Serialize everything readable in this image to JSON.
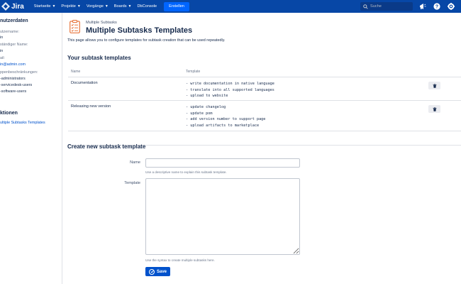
{
  "topnav": {
    "logo_text": "Jira",
    "items": [
      {
        "label": "Startseite"
      },
      {
        "label": "Projekte"
      },
      {
        "label": "Vorgänge"
      },
      {
        "label": "Boards"
      },
      {
        "label": "DbConsole"
      }
    ],
    "create_label": "Erstellen",
    "search_placeholder": "Suche"
  },
  "sidebar": {
    "heading": "nutzerdaten",
    "username_label": "utzername:",
    "username_value": "in",
    "fullname_label": "ständiger Name:",
    "fullname_value": "in",
    "email_label": "ail:",
    "email_value": "in@admin.com",
    "groups_label": "ppenbeschränkungen:",
    "groups": [
      "-administrators",
      "-servicedesk-users",
      "-software-users"
    ],
    "actions_heading": "ktionen",
    "actions": [
      "ultiple Subtasks Templates"
    ]
  },
  "main": {
    "breadcrumb": "Multiple Subtasks",
    "title": "Multiple Subtasks Templates",
    "intro": "This page allows you to configure templates for subtask creation that can be used repeatedly.",
    "templates_heading": "Your subtask templates",
    "table": {
      "col_name": "Name",
      "col_template": "Template",
      "rows": [
        {
          "name": "Documentation",
          "template": "- write documentation in native language\n- translate into all supported languages\n- upload to website"
        },
        {
          "name": "Releasing new version",
          "template": "- update changelog\n- update pom\n- add version number to support page\n- upload artifacts to marketplace"
        }
      ]
    },
    "create_heading": "Create new subtask template",
    "form": {
      "name_label": "Name",
      "name_value": "",
      "name_hint": "Use a descriptive name to explain this subtask template.",
      "template_label": "Template",
      "template_value": "",
      "template_hint": "Use the syntax to create multiple subtasks here.",
      "save_label": "Save"
    }
  },
  "colors": {
    "nav_bg": "#0747a6",
    "create_bg": "#0065ff",
    "primary": "#0052cc",
    "text": "#172b4d",
    "muted": "#6b778c",
    "icon_accent": "#e8743b"
  }
}
